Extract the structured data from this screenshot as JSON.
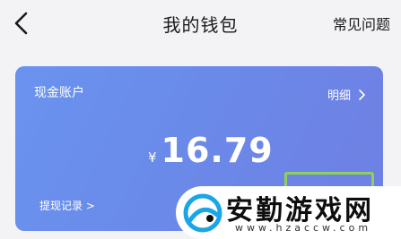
{
  "header": {
    "title": "我的钱包",
    "faq_label": "常见问题"
  },
  "card": {
    "label": "现金账户",
    "detail_label": "明细",
    "currency": "¥",
    "amount": "16.79",
    "withdraw_record_label": "提现记录 >",
    "gradient_colors": [
      "#6a93ef",
      "#6f7fe3"
    ]
  },
  "watermark": {
    "text": "安勤游戏网",
    "url": "www.hzaccw.com",
    "accent_color": "#1aa6e6"
  }
}
